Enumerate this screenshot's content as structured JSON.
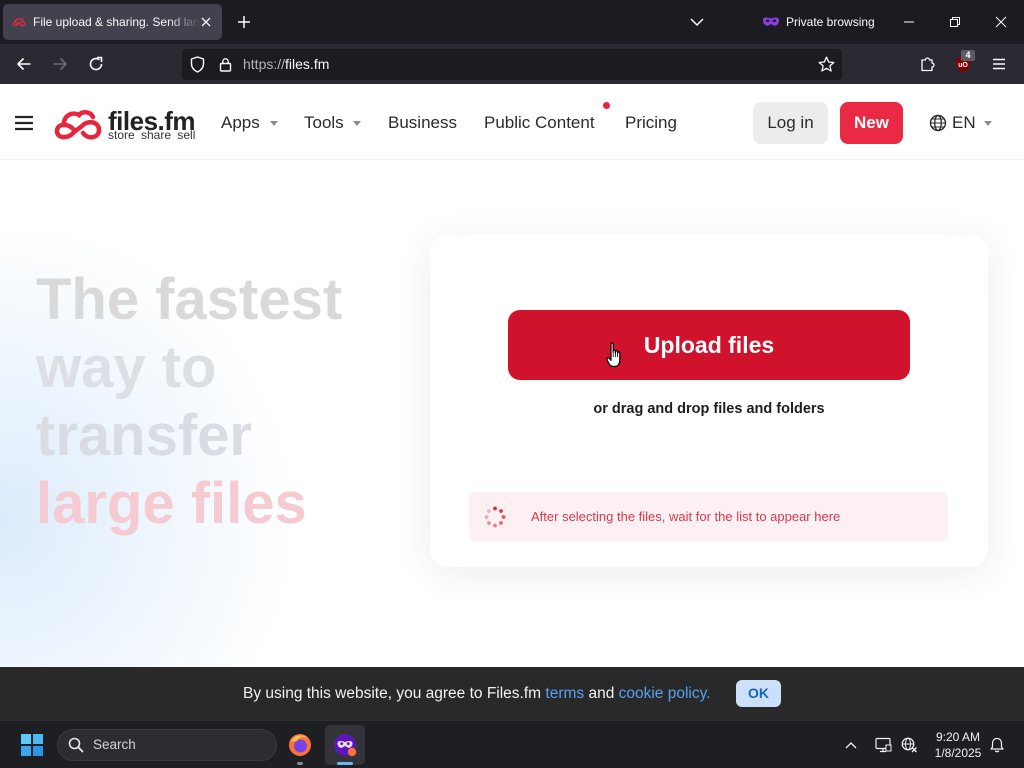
{
  "browser": {
    "active_tab": {
      "title": "File upload & sharing. Send larg"
    },
    "private_label": "Private browsing",
    "url": {
      "scheme": "https://",
      "host": "files.fm"
    },
    "extension_badge": "4"
  },
  "site_header": {
    "logo": {
      "wordmark": "files.fm",
      "tagline": "store share sell"
    },
    "nav": [
      {
        "label": "Apps",
        "dropdown": true
      },
      {
        "label": "Tools",
        "dropdown": true
      },
      {
        "label": "Business",
        "dropdown": false
      },
      {
        "label": "Public Content",
        "dropdown": false,
        "notification_dot": true
      },
      {
        "label": "Pricing",
        "dropdown": false
      }
    ],
    "login_label": "Log in",
    "new_label": "New",
    "language": "EN"
  },
  "hero": {
    "headline_lines": [
      "The fastest",
      "way to",
      "transfer"
    ],
    "headline_highlight": "large files"
  },
  "upload_card": {
    "button_label": "Upload files",
    "drop_hint": "or drag and drop files and folders",
    "wait_notice": "After selecting the files, wait for the list to appear here"
  },
  "cookie_banner": {
    "text_before": "By using this website, you agree to Files.fm ",
    "terms_link": "terms",
    "text_between": " and ",
    "policy_link": "cookie policy.",
    "ok_label": "OK"
  },
  "taskbar": {
    "search_label": "Search",
    "time": "9:20 AM",
    "date": "1/8/2025"
  },
  "icons": {
    "browser": [
      "files-fm-favicon",
      "tab-close",
      "new-tab-plus",
      "tab-list-chevron",
      "private-mask",
      "minimize",
      "restore",
      "window-close",
      "back-arrow",
      "forward-arrow",
      "reload",
      "tracking-shield",
      "lock",
      "bookmark-star",
      "extensions-puzzle",
      "ublock-origin",
      "app-menu"
    ],
    "page": [
      "hamburger-menu",
      "files-fm-logo",
      "globe",
      "loading-spinner",
      "hand-pointer-cursor"
    ],
    "taskbar": [
      "windows-start",
      "search",
      "firefox",
      "firefox-private",
      "show-hidden-chevron",
      "display",
      "network",
      "notification-bell"
    ]
  },
  "colors": {
    "brand_red": "#e8253f",
    "upload_button_red": "#d1122c",
    "new_button_red": "#ea2a44",
    "notice_background": "#fdf0f2",
    "notice_text": "#d63a52",
    "cookie_link_blue": "#56a3f0",
    "private_purple": "#7b2fd6"
  }
}
